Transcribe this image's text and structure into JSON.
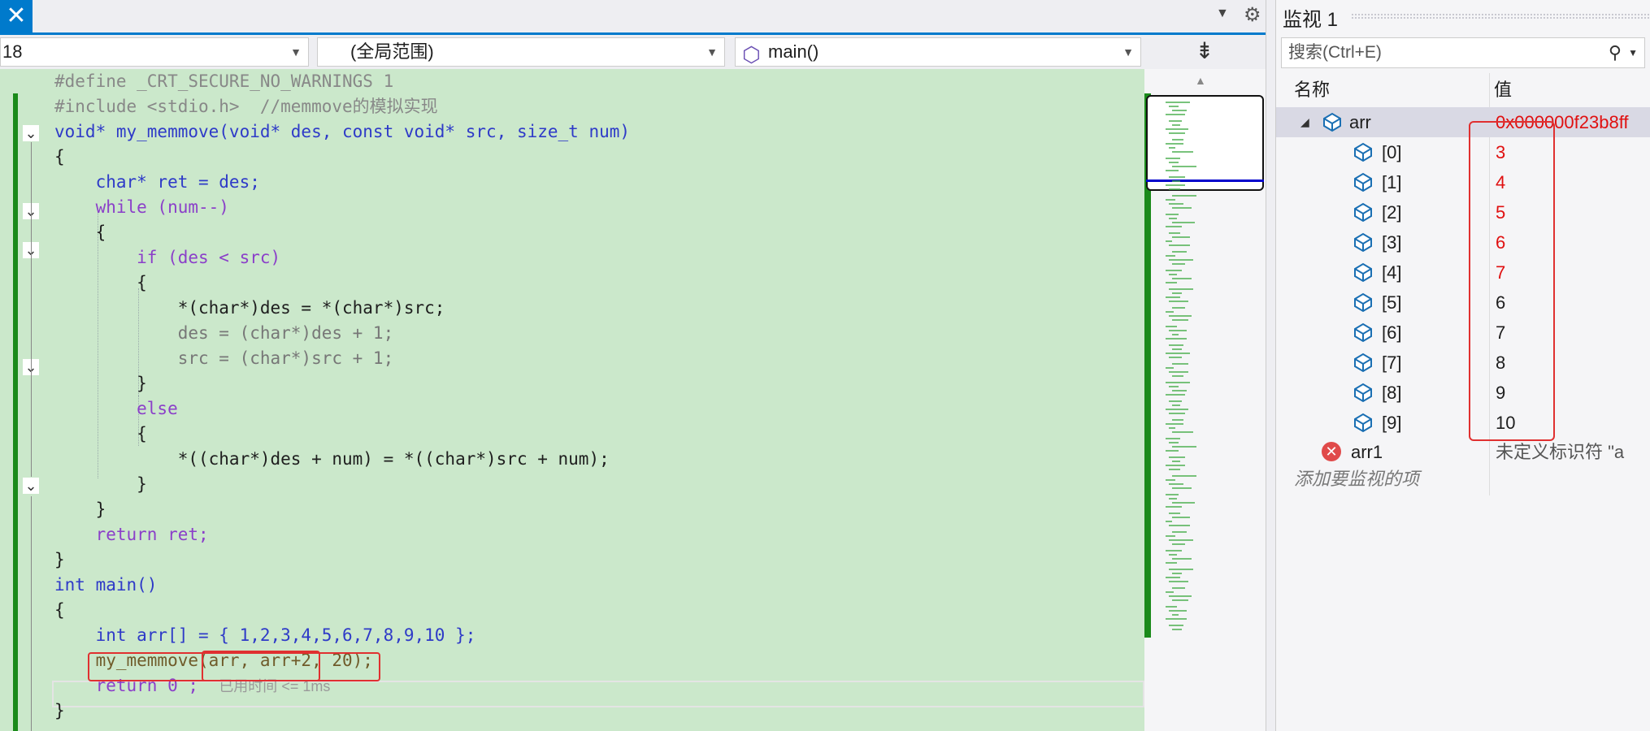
{
  "editor": {
    "close_tab_glyph": "✕",
    "tab_dropdown_glyph": "▼",
    "settings_glyph": "⚙",
    "nav": {
      "project": "18",
      "scope": "(全局范围)",
      "function": "main()",
      "split_glyph": "⇟"
    },
    "code": [
      "#define _CRT_SECURE_NO_WARNINGS 1",
      "#include <stdio.h>  //memmove的模拟实现",
      "void* my_memmove(void* des, const void* src, size_t num)",
      "{",
      "    char* ret = des;",
      "    while (num--)",
      "    {",
      "        if (des < src)",
      "        {",
      "            *(char*)des = *(char*)src;",
      "            des = (char*)des + 1;",
      "            src = (char*)src + 1;",
      "        }",
      "        else",
      "        {",
      "            *((char*)des + num) = *((char*)src + num);",
      "        }",
      "    }",
      "    return ret;",
      "}",
      "int main()",
      "{",
      "    int arr[] = { 1,2,3,4,5,6,7,8,9,10 };",
      "    my_memmove(arr, arr+2, 20);",
      "    return 0 ;",
      "}"
    ],
    "elapsed_hint": "已用时间 <= 1ms"
  },
  "watch": {
    "title": "监视 1",
    "search_placeholder": "搜索(Ctrl+E)",
    "search_icon": "⚲",
    "columns": {
      "name": "名称",
      "value": "值"
    },
    "root": {
      "name": "arr",
      "value": "0x000000f23b8ff"
    },
    "items": [
      {
        "name": "[0]",
        "value": "3",
        "changed": true
      },
      {
        "name": "[1]",
        "value": "4",
        "changed": true
      },
      {
        "name": "[2]",
        "value": "5",
        "changed": true
      },
      {
        "name": "[3]",
        "value": "6",
        "changed": true
      },
      {
        "name": "[4]",
        "value": "7",
        "changed": true
      },
      {
        "name": "[5]",
        "value": "6",
        "changed": false
      },
      {
        "name": "[6]",
        "value": "7",
        "changed": false
      },
      {
        "name": "[7]",
        "value": "8",
        "changed": false
      },
      {
        "name": "[8]",
        "value": "9",
        "changed": false
      },
      {
        "name": "[9]",
        "value": "10",
        "changed": false
      }
    ],
    "error_row": {
      "name": "arr1",
      "value": "未定义标识符 \"a"
    },
    "add_item": "添加要监视的项"
  },
  "colors": {
    "accent": "#007acc",
    "changed_value": "#e01010",
    "code_bg": "#cbe8cb",
    "annotation_red": "#e03030"
  }
}
